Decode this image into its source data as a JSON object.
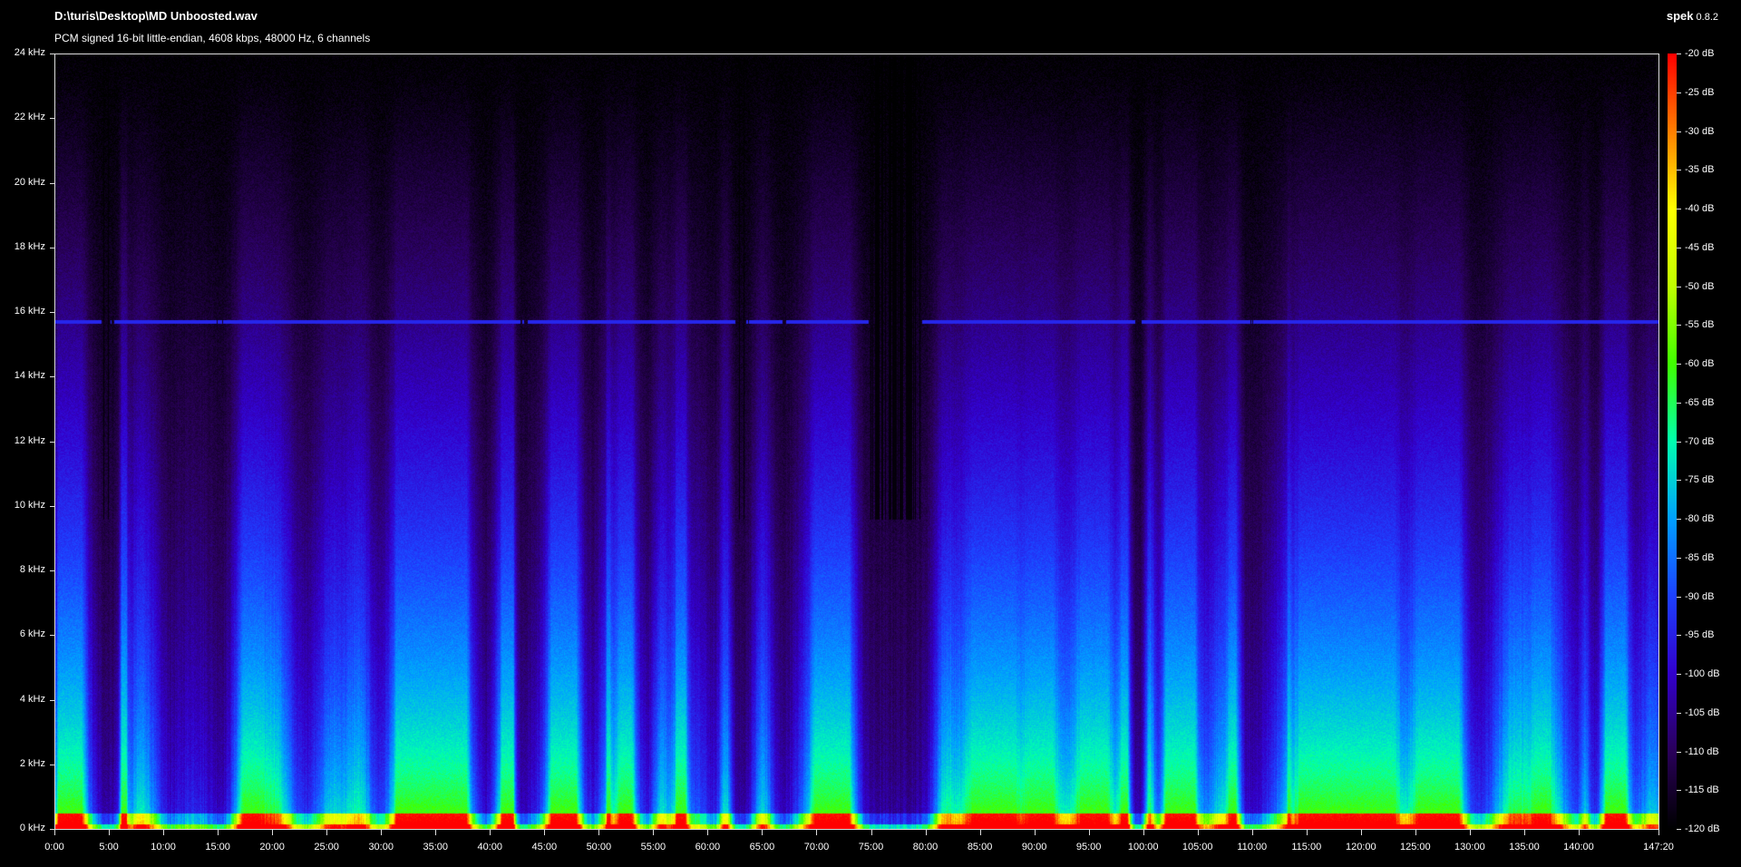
{
  "window": {
    "title": "D:\\turis\\Desktop\\MD Unboosted.wav",
    "subtitle": "PCM signed 16-bit little-endian, 4608 kbps, 48000 Hz, 6 channels",
    "app_name": "spek",
    "app_version": "0.8.2"
  },
  "axes": {
    "frequency_labels": [
      "24 kHz",
      "22 kHz",
      "20 kHz",
      "18 kHz",
      "16 kHz",
      "14 kHz",
      "12 kHz",
      "10 kHz",
      "8 kHz",
      "6 kHz",
      "4 kHz",
      "2 kHz",
      "0 kHz"
    ],
    "time_labels": [
      "0:00",
      "5:00",
      "10:00",
      "15:00",
      "20:00",
      "25:00",
      "30:00",
      "35:00",
      "40:00",
      "45:00",
      "50:00",
      "55:00",
      "60:00",
      "65:00",
      "70:00",
      "75:00",
      "80:00",
      "85:00",
      "90:00",
      "95:00",
      "100:00",
      "105:00",
      "110:00",
      "115:00",
      "120:00",
      "125:00",
      "130:00",
      "135:00",
      "140:00",
      "147:20"
    ],
    "db_labels": [
      "-20 dB",
      "-25 dB",
      "-30 dB",
      "-35 dB",
      "-40 dB",
      "-45 dB",
      "-50 dB",
      "-55 dB",
      "-60 dB",
      "-65 dB",
      "-70 dB",
      "-75 dB",
      "-80 dB",
      "-85 dB",
      "-90 dB",
      "-95 dB",
      "-100 dB",
      "-105 dB",
      "-110 dB",
      "-115 dB",
      "-120 dB"
    ],
    "frequency_range_khz": [
      0,
      24
    ],
    "time_range_min": [
      0,
      147.333
    ],
    "db_range": [
      -120,
      -20
    ]
  },
  "colors": {
    "background": "#000000",
    "colormap": [
      "#000000",
      "#2a005a",
      "#3300cc",
      "#1e40ff",
      "#00a0ff",
      "#00ffb0",
      "#40ff00",
      "#c0ff00",
      "#ffff00",
      "#ff8000",
      "#ff0000"
    ]
  }
}
